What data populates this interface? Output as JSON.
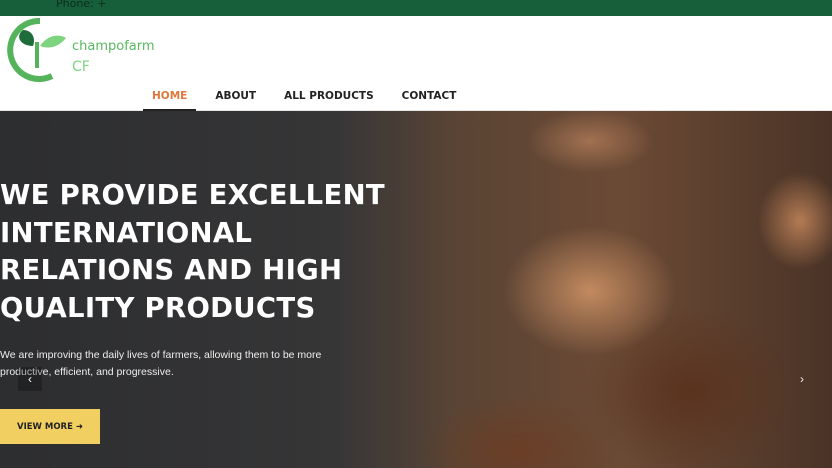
{
  "topbar": {
    "text": "Phone: +"
  },
  "brand": {
    "name": "champofarm",
    "abbr": "CF"
  },
  "nav": {
    "items": [
      {
        "label": "HOME",
        "active": true
      },
      {
        "label": "ABOUT"
      },
      {
        "label": "ALL PRODUCTS"
      },
      {
        "label": "CONTACT"
      }
    ]
  },
  "hero": {
    "title": "WE PROVIDE EXCELLENT INTERNATIONAL RELATIONS AND HIGH QUALITY PRODUCTS",
    "subtitle": "We are improving the daily lives of farmers, allowing them to be more productive, efficient, and progressive.",
    "button_label": "VIEW MORE",
    "button_icon": "arrow-right",
    "prev_icon": "chevron-left",
    "next_icon": "chevron-right"
  },
  "colors": {
    "topbar": "#175f3a",
    "accent": "#e0773b",
    "button": "#f1cf61",
    "brand": "#59b95f"
  }
}
